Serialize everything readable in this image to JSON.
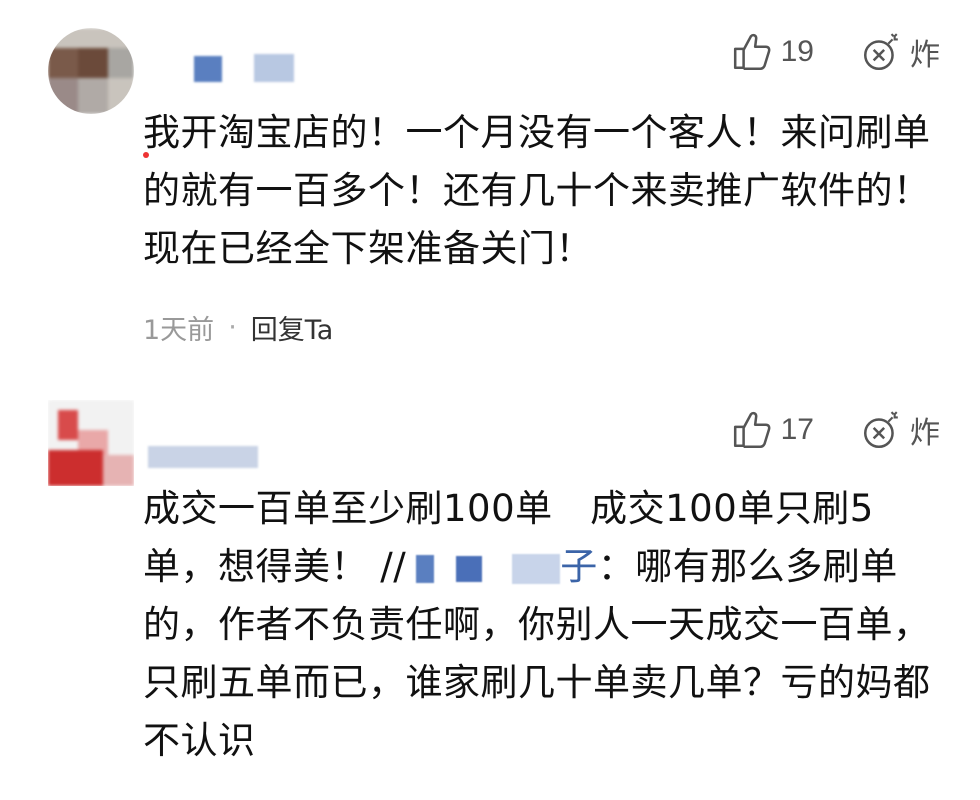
{
  "comments": [
    {
      "likes": "19",
      "bomb_label": "炸",
      "text": "我开淘宝店的！一个月没有一个客人！来问刷单的就有一百多个！还有几十个来卖推广软件的！现在已经全下架准备关门！",
      "time": "1天前",
      "separator": "·",
      "reply_label": "回复Ta"
    },
    {
      "likes": "17",
      "bomb_label": "炸",
      "text_part1": "成交一百单至少刷100单　成交100单只刷5单，想得美！ //",
      "mention_suffix": "子",
      "text_part2": "：哪有那么多刷单的，作者不负责任啊，你别人一天成交一百单，只刷五单而已，谁家刷几十单卖几单？亏的妈都不认识"
    }
  ],
  "colors": {
    "text": "#111111",
    "meta": "#999999",
    "icon": "#555555",
    "mention": "#3b64a8"
  },
  "icons": [
    "thumbs-up-icon",
    "bomb-icon"
  ]
}
